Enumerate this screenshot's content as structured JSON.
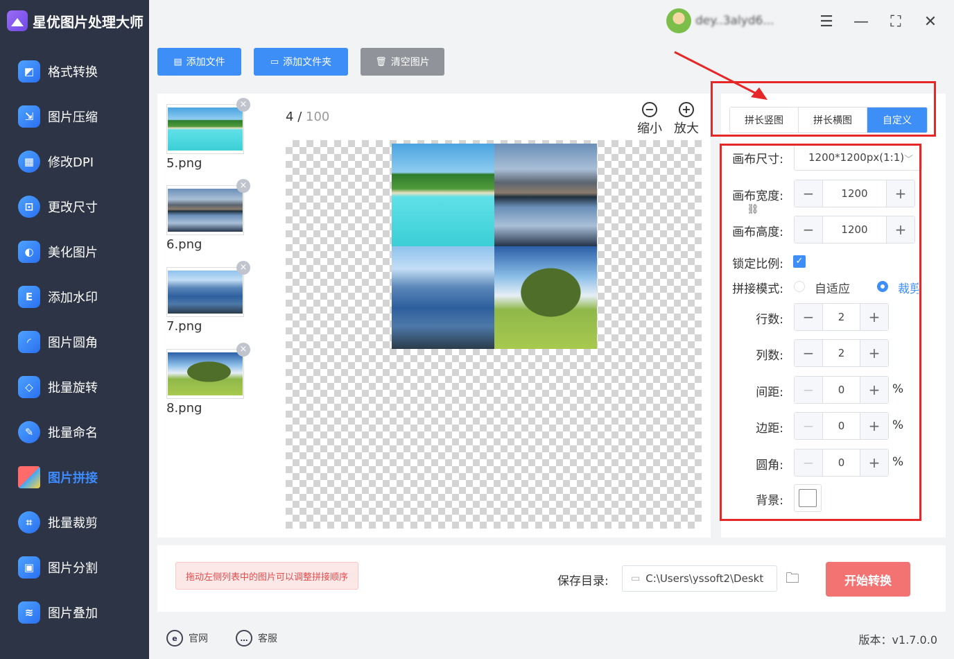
{
  "app": {
    "title": "星优图片处理大师"
  },
  "sidebar": {
    "items": [
      {
        "label": "格式转换",
        "icon": "image-convert-icon"
      },
      {
        "label": "图片压缩",
        "icon": "compress-icon"
      },
      {
        "label": "修改DPI",
        "icon": "dpi-icon"
      },
      {
        "label": "更改尺寸",
        "icon": "resize-icon"
      },
      {
        "label": "美化图片",
        "icon": "beautify-icon"
      },
      {
        "label": "添加水印",
        "icon": "watermark-icon"
      },
      {
        "label": "图片圆角",
        "icon": "rounded-corner-icon"
      },
      {
        "label": "批量旋转",
        "icon": "rotate-icon"
      },
      {
        "label": "批量命名",
        "icon": "rename-icon"
      },
      {
        "label": "图片拼接",
        "icon": "puzzle-icon",
        "active": true
      },
      {
        "label": "批量裁剪",
        "icon": "crop-icon"
      },
      {
        "label": "图片分割",
        "icon": "split-icon"
      },
      {
        "label": "图片叠加",
        "icon": "layers-icon"
      }
    ]
  },
  "header": {
    "username": "dey..3alyd6..."
  },
  "toolbar": {
    "add_file": "添加文件",
    "add_folder": "添加文件夹",
    "clear": "清空图片"
  },
  "files": [
    {
      "name": "5.png"
    },
    {
      "name": "6.png"
    },
    {
      "name": "7.png"
    },
    {
      "name": "8.png"
    }
  ],
  "preview": {
    "current": "4",
    "separator": "/",
    "total": "100",
    "zoom_out": "缩小",
    "zoom_in": "放大"
  },
  "settings": {
    "tabs": [
      {
        "label": "拼长竖图"
      },
      {
        "label": "拼长横图"
      },
      {
        "label": "自定义",
        "active": true
      }
    ],
    "canvas_size_label": "画布尺寸:",
    "canvas_size_value": "1200*1200px(1:1)",
    "width_label": "画布宽度:",
    "width_value": "1200",
    "height_label": "画布高度:",
    "height_value": "1200",
    "lock_label": "锁定比例:",
    "lock_checked": true,
    "mode_label": "拼接模式:",
    "mode_options": [
      "自适应",
      "裁剪"
    ],
    "mode_selected": "裁剪",
    "rows_label": "行数:",
    "rows_value": "2",
    "cols_label": "列数:",
    "cols_value": "2",
    "spacing_label": "间距:",
    "spacing_value": "0",
    "margin_label": "边距:",
    "margin_value": "0",
    "radius_label": "圆角:",
    "radius_value": "0",
    "percent": "%",
    "background_label": "背景:",
    "background_color": "#ffffff"
  },
  "bottom": {
    "hint": "拖动左侧列表中的图片可以调整拼接顺序",
    "save_label": "保存目录:",
    "save_path": "C:\\Users\\yssoft2\\Deskt",
    "start": "开始转换"
  },
  "footer": {
    "website": "官网",
    "support": "客服",
    "version": "版本：v1.7.0.0"
  },
  "colors": {
    "accent": "#3e8ef7",
    "sidebar": "#2c3445",
    "start_button": "#f37373",
    "annotation": "#e52727"
  }
}
